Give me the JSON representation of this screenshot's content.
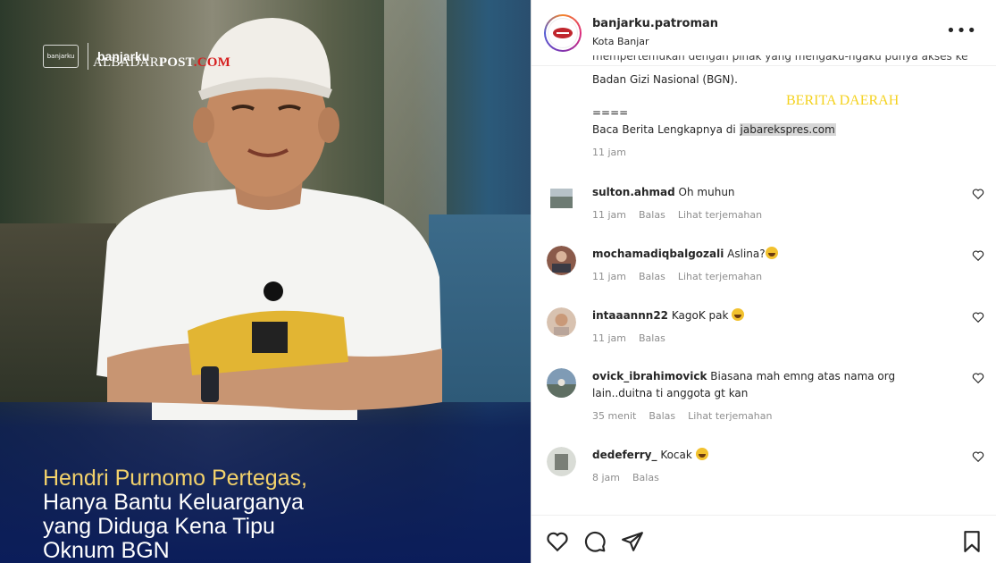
{
  "image_overlay": {
    "brand_name": "banjarku",
    "brand_mark_text": "banjarku",
    "watermark_1": "ALBADAR",
    "watermark_2": "POST",
    "watermark_3": ".COM",
    "headline_lines": [
      "Hendri Purnomo Pertegas,",
      "Hanya Bantu Keluarganya",
      "yang Diduga Kena Tipu",
      "Oknum BGN"
    ]
  },
  "header": {
    "username": "banjarku.patroman",
    "location": "Kota Banjar",
    "more_label": "•••"
  },
  "caption": {
    "clipped_line": "mempertemukan dengan pihak yang mengaku-ngaku punya akses ke",
    "line_1": "Badan Gizi Nasional (BGN).",
    "separator": "====",
    "read_more_prefix": "Baca Berita Lengkapnya di ",
    "read_more_link": "jabarekspres.com",
    "time": "11 jam"
  },
  "watermark_right": "BERITA DAERAH",
  "comments": [
    {
      "user": "sulton.ahmad",
      "text": "Oh muhun",
      "emoji": false,
      "time": "11 jam",
      "reply": "Balas",
      "translate": "Lihat terjemahan"
    },
    {
      "user": "mochamadiqbalgozali",
      "text": "Aslina?",
      "emoji": true,
      "time": "11 jam",
      "reply": "Balas",
      "translate": "Lihat terjemahan"
    },
    {
      "user": "intaaannn22",
      "text": "KagoK pak",
      "emoji": true,
      "time": "11 jam",
      "reply": "Balas",
      "translate": ""
    },
    {
      "user": "ovick_ibrahimovick",
      "text": "Biasana mah emng atas nama org lain..duitna ti anggota gt kan",
      "emoji": false,
      "time": "35 menit",
      "reply": "Balas",
      "translate": "Lihat terjemahan"
    },
    {
      "user": "dedeferry_",
      "text": "Kocak",
      "emoji": true,
      "time": "8 jam",
      "reply": "Balas",
      "translate": ""
    }
  ],
  "colors": {
    "headline_gold": "#f3d26b",
    "watermark_red": "#d61f1f",
    "watermark_yellow": "#f4d21f",
    "meta_gray": "#8e8e8e"
  },
  "icons": {
    "like": "heart-icon",
    "comment": "comment-icon",
    "share": "send-icon",
    "save": "bookmark-icon",
    "more": "more-options-icon"
  }
}
